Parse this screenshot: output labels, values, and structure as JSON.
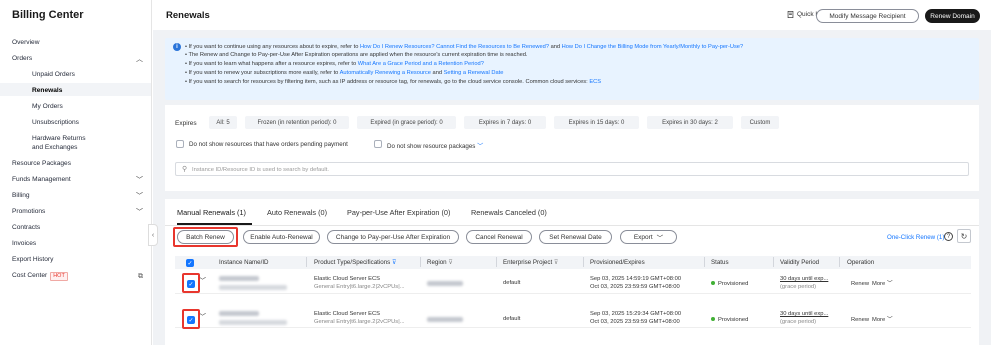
{
  "sidebar": {
    "title": "Billing Center",
    "items": [
      {
        "label": "Overview"
      },
      {
        "label": "Orders"
      },
      {
        "label": "Unpaid Orders"
      },
      {
        "label": "Renewals"
      },
      {
        "label": "My Orders"
      },
      {
        "label": "Unsubscriptions"
      },
      {
        "label": "Hardware Returns"
      },
      {
        "label": "and Exchanges"
      },
      {
        "label": "Resource Packages"
      },
      {
        "label": "Funds Management"
      },
      {
        "label": "Billing"
      },
      {
        "label": "Promotions"
      },
      {
        "label": "Contracts"
      },
      {
        "label": "Invoices"
      },
      {
        "label": "Export History"
      },
      {
        "label": "Cost Center"
      }
    ],
    "hot_badge": "HOT"
  },
  "header": {
    "title": "Renewals",
    "quick_links": "Quick Links",
    "modify_recipient": "Modify Message Recipient",
    "renew_domain": "Renew Domain"
  },
  "notice": {
    "lines": [
      {
        "pre": "If you want to continue using any resources about to expire, refer to ",
        "link": "How Do I Renew Resources? Cannot Find the Resources to Be Renewed?",
        "mid": " and ",
        "link2": "How Do I Change the Billing Mode from Yearly/Monthly to Pay-per-Use?",
        "post": ""
      },
      {
        "pre": "The Renew and Change to Pay-per-Use After Expiration operations are applied when the resource's current expiration time is reached.",
        "link": "",
        "mid": "",
        "link2": "",
        "post": ""
      },
      {
        "pre": "If you want to learn what happens after a resource expires, refer to ",
        "link": "What Are a Grace Period and a Retention Period?",
        "mid": "",
        "link2": "",
        "post": ""
      },
      {
        "pre": "If you want to renew your subscriptions more easily, refer to ",
        "link": "Automatically Renewing a Resource",
        "mid": " and ",
        "link2": "Setting a Renewal Date",
        "post": ""
      },
      {
        "pre": "If you want to search for resources by filtering item, such as IP address or resource tag, for renewals, go to the cloud service console. Common cloud services: ",
        "link": "ECS",
        "mid": "",
        "link2": "",
        "post": ""
      }
    ]
  },
  "filters": {
    "expires_label": "Expires",
    "chips": [
      "All: 5",
      "Frozen (in retention period): 0",
      "Expired (in grace period): 0",
      "Expires in 7 days: 0",
      "Expires in 15 days: 0",
      "Expires in 30 days: 2",
      "Custom"
    ],
    "hide_pending": "Do not show resources that have orders pending payment",
    "hide_packages": "Do not show resource packages",
    "search_placeholder": "Instance ID/Resource ID is used to search by default."
  },
  "tabs": [
    "Manual Renewals (1)",
    "Auto Renewals (0)",
    "Pay-per-Use After Expiration (0)",
    "Renewals Canceled (0)"
  ],
  "actions": {
    "batch_renew": "Batch Renew",
    "enable_auto": "Enable Auto-Renewal",
    "change_ppu": "Change to Pay-per-Use After Expiration",
    "cancel_renewal": "Cancel Renewal",
    "set_date": "Set Renewal Date",
    "export": "Export",
    "one_click": "One-Click Renew (1)"
  },
  "table": {
    "columns": [
      "Instance Name/ID",
      "Product Type/Specifications",
      "Region",
      "Enterprise Project",
      "Provisioned/Expires",
      "Status",
      "Validity Period",
      "Operation"
    ],
    "rows": [
      {
        "product": "Elastic Cloud Server ECS",
        "spec": "General Entry|t6.large.2|2vCPUs|...",
        "project": "default",
        "provisioned": "Sep 03, 2025 14:59:19 GMT+08:00",
        "expires": "Oct 03, 2025 23:59:59 GMT+08:00",
        "status": "Provisioned",
        "validity": "30 days until exp...",
        "grace": "(grace period)",
        "renew": "Renew",
        "more": "More"
      },
      {
        "product": "Elastic Cloud Server ECS",
        "spec": "General Entry|t6.large.2|2vCPUs|...",
        "project": "default",
        "provisioned": "Sep 03, 2025 15:29:34 GMT+08:00",
        "expires": "Oct 03, 2025 23:59:59 GMT+08:00",
        "status": "Provisioned",
        "validity": "30 days until exp...",
        "grace": "(grace period)",
        "renew": "Renew",
        "more": "More"
      }
    ]
  },
  "colors": {
    "accent": "#1476ff",
    "highlight": "#e8362d",
    "status_ok": "#41b035",
    "dark": "#191919"
  }
}
